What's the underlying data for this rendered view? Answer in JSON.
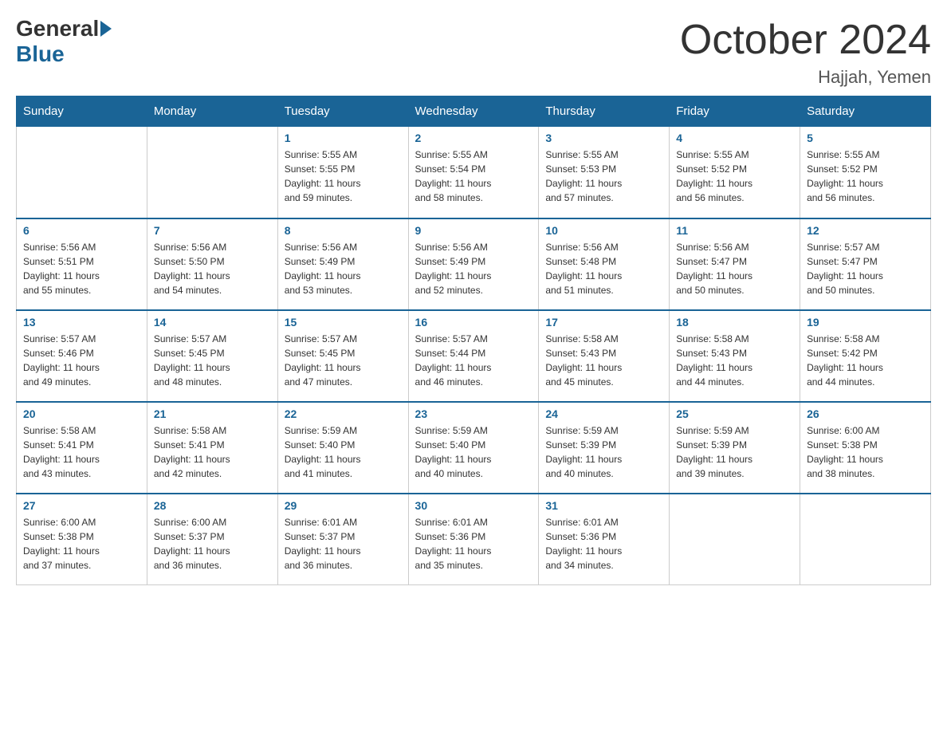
{
  "header": {
    "logo_general": "General",
    "logo_blue": "Blue",
    "month_title": "October 2024",
    "location": "Hajjah, Yemen"
  },
  "weekdays": [
    "Sunday",
    "Monday",
    "Tuesday",
    "Wednesday",
    "Thursday",
    "Friday",
    "Saturday"
  ],
  "weeks": [
    [
      {
        "day": "",
        "info": ""
      },
      {
        "day": "",
        "info": ""
      },
      {
        "day": "1",
        "info": "Sunrise: 5:55 AM\nSunset: 5:55 PM\nDaylight: 11 hours\nand 59 minutes."
      },
      {
        "day": "2",
        "info": "Sunrise: 5:55 AM\nSunset: 5:54 PM\nDaylight: 11 hours\nand 58 minutes."
      },
      {
        "day": "3",
        "info": "Sunrise: 5:55 AM\nSunset: 5:53 PM\nDaylight: 11 hours\nand 57 minutes."
      },
      {
        "day": "4",
        "info": "Sunrise: 5:55 AM\nSunset: 5:52 PM\nDaylight: 11 hours\nand 56 minutes."
      },
      {
        "day": "5",
        "info": "Sunrise: 5:55 AM\nSunset: 5:52 PM\nDaylight: 11 hours\nand 56 minutes."
      }
    ],
    [
      {
        "day": "6",
        "info": "Sunrise: 5:56 AM\nSunset: 5:51 PM\nDaylight: 11 hours\nand 55 minutes."
      },
      {
        "day": "7",
        "info": "Sunrise: 5:56 AM\nSunset: 5:50 PM\nDaylight: 11 hours\nand 54 minutes."
      },
      {
        "day": "8",
        "info": "Sunrise: 5:56 AM\nSunset: 5:49 PM\nDaylight: 11 hours\nand 53 minutes."
      },
      {
        "day": "9",
        "info": "Sunrise: 5:56 AM\nSunset: 5:49 PM\nDaylight: 11 hours\nand 52 minutes."
      },
      {
        "day": "10",
        "info": "Sunrise: 5:56 AM\nSunset: 5:48 PM\nDaylight: 11 hours\nand 51 minutes."
      },
      {
        "day": "11",
        "info": "Sunrise: 5:56 AM\nSunset: 5:47 PM\nDaylight: 11 hours\nand 50 minutes."
      },
      {
        "day": "12",
        "info": "Sunrise: 5:57 AM\nSunset: 5:47 PM\nDaylight: 11 hours\nand 50 minutes."
      }
    ],
    [
      {
        "day": "13",
        "info": "Sunrise: 5:57 AM\nSunset: 5:46 PM\nDaylight: 11 hours\nand 49 minutes."
      },
      {
        "day": "14",
        "info": "Sunrise: 5:57 AM\nSunset: 5:45 PM\nDaylight: 11 hours\nand 48 minutes."
      },
      {
        "day": "15",
        "info": "Sunrise: 5:57 AM\nSunset: 5:45 PM\nDaylight: 11 hours\nand 47 minutes."
      },
      {
        "day": "16",
        "info": "Sunrise: 5:57 AM\nSunset: 5:44 PM\nDaylight: 11 hours\nand 46 minutes."
      },
      {
        "day": "17",
        "info": "Sunrise: 5:58 AM\nSunset: 5:43 PM\nDaylight: 11 hours\nand 45 minutes."
      },
      {
        "day": "18",
        "info": "Sunrise: 5:58 AM\nSunset: 5:43 PM\nDaylight: 11 hours\nand 44 minutes."
      },
      {
        "day": "19",
        "info": "Sunrise: 5:58 AM\nSunset: 5:42 PM\nDaylight: 11 hours\nand 44 minutes."
      }
    ],
    [
      {
        "day": "20",
        "info": "Sunrise: 5:58 AM\nSunset: 5:41 PM\nDaylight: 11 hours\nand 43 minutes."
      },
      {
        "day": "21",
        "info": "Sunrise: 5:58 AM\nSunset: 5:41 PM\nDaylight: 11 hours\nand 42 minutes."
      },
      {
        "day": "22",
        "info": "Sunrise: 5:59 AM\nSunset: 5:40 PM\nDaylight: 11 hours\nand 41 minutes."
      },
      {
        "day": "23",
        "info": "Sunrise: 5:59 AM\nSunset: 5:40 PM\nDaylight: 11 hours\nand 40 minutes."
      },
      {
        "day": "24",
        "info": "Sunrise: 5:59 AM\nSunset: 5:39 PM\nDaylight: 11 hours\nand 40 minutes."
      },
      {
        "day": "25",
        "info": "Sunrise: 5:59 AM\nSunset: 5:39 PM\nDaylight: 11 hours\nand 39 minutes."
      },
      {
        "day": "26",
        "info": "Sunrise: 6:00 AM\nSunset: 5:38 PM\nDaylight: 11 hours\nand 38 minutes."
      }
    ],
    [
      {
        "day": "27",
        "info": "Sunrise: 6:00 AM\nSunset: 5:38 PM\nDaylight: 11 hours\nand 37 minutes."
      },
      {
        "day": "28",
        "info": "Sunrise: 6:00 AM\nSunset: 5:37 PM\nDaylight: 11 hours\nand 36 minutes."
      },
      {
        "day": "29",
        "info": "Sunrise: 6:01 AM\nSunset: 5:37 PM\nDaylight: 11 hours\nand 36 minutes."
      },
      {
        "day": "30",
        "info": "Sunrise: 6:01 AM\nSunset: 5:36 PM\nDaylight: 11 hours\nand 35 minutes."
      },
      {
        "day": "31",
        "info": "Sunrise: 6:01 AM\nSunset: 5:36 PM\nDaylight: 11 hours\nand 34 minutes."
      },
      {
        "day": "",
        "info": ""
      },
      {
        "day": "",
        "info": ""
      }
    ]
  ]
}
